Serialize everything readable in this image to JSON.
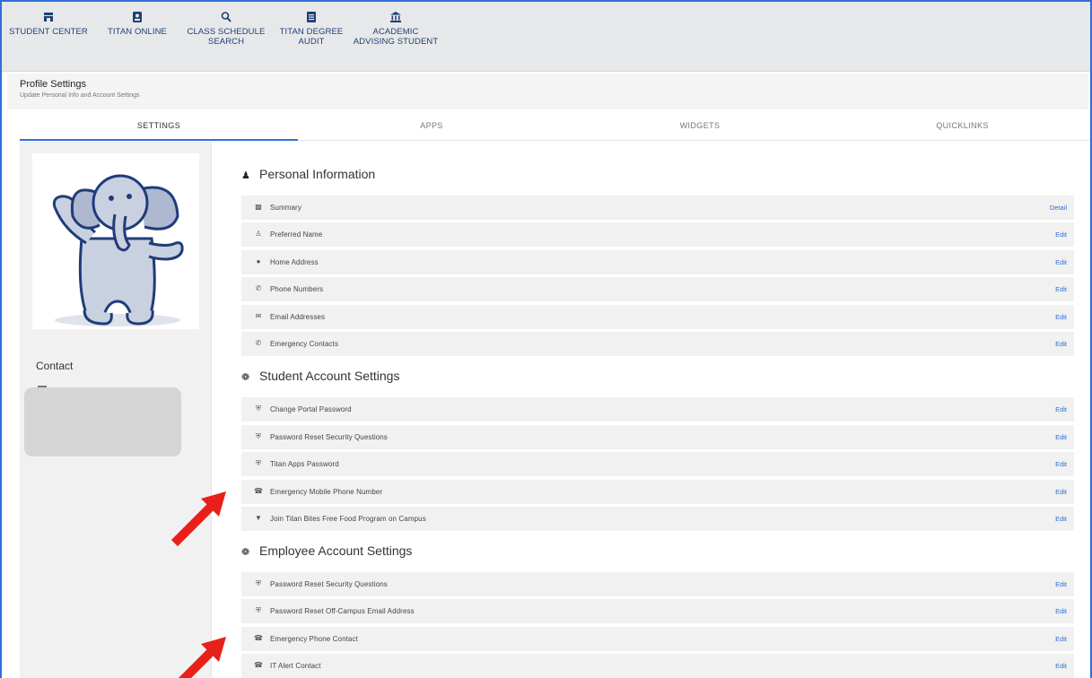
{
  "nav": [
    {
      "label": "STUDENT CENTER",
      "icon": "store-icon"
    },
    {
      "label": "TITAN ONLINE",
      "icon": "badge-icon"
    },
    {
      "label": "CLASS SCHEDULE\nSEARCH",
      "icon": "search-icon"
    },
    {
      "label": "TITAN DEGREE\nAUDIT",
      "icon": "document-icon"
    },
    {
      "label": "ACADEMIC\nADVISING STUDENT",
      "icon": "institution-icon"
    }
  ],
  "header": {
    "title": "Profile Settings",
    "subtitle": "Update Personal Info and Account Settings"
  },
  "tabs": [
    "SETTINGS",
    "APPS",
    "WIDGETS",
    "QUICKLINKS"
  ],
  "sidebar": {
    "contact_label": "Contact"
  },
  "sections": [
    {
      "title": "Personal Information",
      "icon": "person-icon",
      "rows": [
        {
          "label": "Summary",
          "action": "Detail",
          "icon": "chart-icon"
        },
        {
          "label": "Preferred Name",
          "action": "Edit",
          "icon": "person-outline-icon"
        },
        {
          "label": "Home Address",
          "action": "Edit",
          "icon": "location-icon"
        },
        {
          "label": "Phone Numbers",
          "action": "Edit",
          "icon": "phone-icon"
        },
        {
          "label": "Email Addresses",
          "action": "Edit",
          "icon": "mail-icon"
        },
        {
          "label": "Emergency Contacts",
          "action": "Edit",
          "icon": "phone-icon"
        }
      ]
    },
    {
      "title": "Student Account Settings",
      "icon": "gear-icon",
      "rows": [
        {
          "label": "Change Portal Password",
          "action": "Edit",
          "icon": "shield-icon"
        },
        {
          "label": "Password Reset Security Questions",
          "action": "Edit",
          "icon": "shield-icon"
        },
        {
          "label": "Titan Apps Password",
          "action": "Edit",
          "icon": "shield-icon"
        },
        {
          "label": "Emergency Mobile Phone Number",
          "action": "Edit",
          "icon": "phone-call-icon"
        },
        {
          "label": "Join Titan Bites Free Food Program on Campus",
          "action": "Edit",
          "icon": "food-icon"
        }
      ]
    },
    {
      "title": "Employee Account Settings",
      "icon": "gear-icon",
      "rows": [
        {
          "label": "Password Reset Security Questions",
          "action": "Edit",
          "icon": "shield-icon"
        },
        {
          "label": "Password Reset Off-Campus Email Address",
          "action": "Edit",
          "icon": "shield-icon"
        },
        {
          "label": "Emergency Phone Contact",
          "action": "Edit",
          "icon": "phone-call-icon"
        },
        {
          "label": "IT Alert Contact",
          "action": "Edit",
          "icon": "phone-call-icon"
        }
      ]
    }
  ],
  "colors": {
    "accent": "#2f6fd6",
    "nav_text": "#1f3f75",
    "arrow": "#e8201a"
  }
}
